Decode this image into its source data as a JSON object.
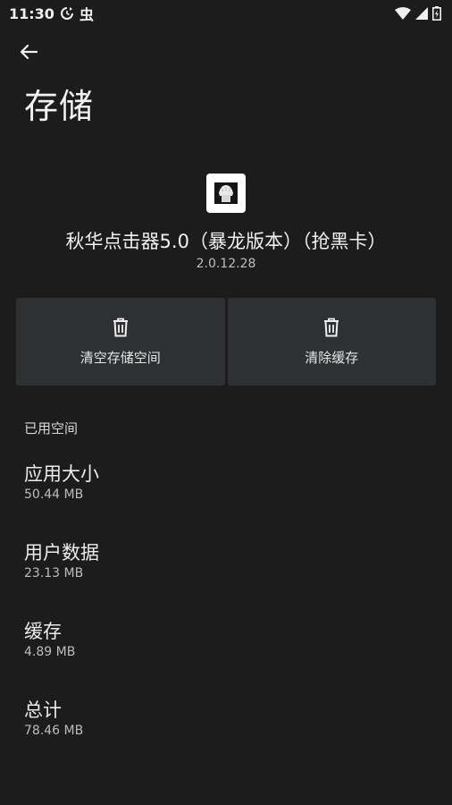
{
  "status_bar": {
    "time": "11:30",
    "left_icons": [
      "sync-icon",
      "bug-glyph"
    ],
    "bug_glyph": "虫",
    "right_icons": [
      "wifi-icon",
      "signal-icon",
      "battery-icon"
    ]
  },
  "header": {
    "back_icon": "arrow-left-icon",
    "title": "存储"
  },
  "app": {
    "name": "秋华点击器5.0（暴龙版本）（抢黑卡）",
    "version": "2.0.12.28"
  },
  "actions": [
    {
      "label": "清空存储空间",
      "icon": "trash-icon"
    },
    {
      "label": "清除缓存",
      "icon": "trash-icon"
    }
  ],
  "storage": {
    "section_title": "已用空间",
    "items": [
      {
        "title": "应用大小",
        "value": "50.44 MB"
      },
      {
        "title": "用户数据",
        "value": "23.13 MB"
      },
      {
        "title": "缓存",
        "value": "4.89 MB"
      },
      {
        "title": "总计",
        "value": "78.46 MB"
      }
    ]
  },
  "colors": {
    "background": "#1c1c1c",
    "button_background": "#2f3032",
    "text_primary": "#ececec",
    "text_secondary": "#bcbcbc"
  }
}
